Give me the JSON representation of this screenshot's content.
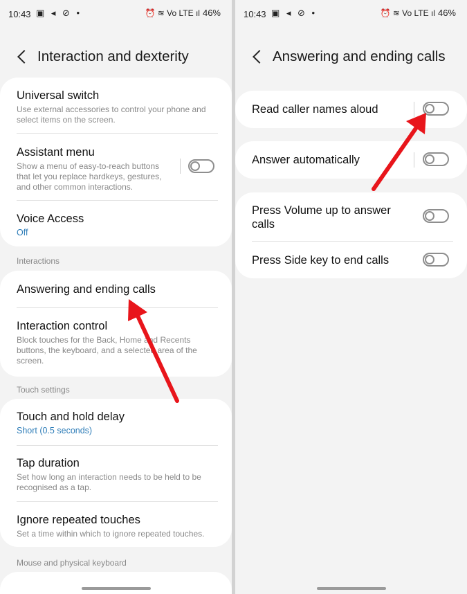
{
  "status": {
    "time": "10:43",
    "left_icons": "▣ ◂ ⊘ •",
    "right_icons": "⏰ ≋ Vo LTE ıl",
    "battery": "46%"
  },
  "left": {
    "title": "Interaction and dexterity",
    "items": [
      {
        "title": "Universal switch",
        "subtitle": "Use external accessories to control your phone and select items on the screen."
      },
      {
        "title": "Assistant menu",
        "subtitle": "Show a menu of easy-to-reach buttons that let you replace hardkeys, gestures, and other common interactions."
      },
      {
        "title": "Voice Access",
        "subtitle": "Off"
      }
    ],
    "section_interactions": "Interactions",
    "interactions": [
      {
        "title": "Answering and ending calls"
      },
      {
        "title": "Interaction control",
        "subtitle": "Block touches for the Back, Home and Recents buttons, the keyboard, and a selected area of the screen."
      }
    ],
    "section_touch": "Touch settings",
    "touch": [
      {
        "title": "Touch and hold delay",
        "subtitle": "Short (0.5 seconds)"
      },
      {
        "title": "Tap duration",
        "subtitle": "Set how long an interaction needs to be held to be recognised as a tap."
      },
      {
        "title": "Ignore repeated touches",
        "subtitle": "Set a time within which to ignore repeated touches."
      }
    ],
    "section_mouse": "Mouse and physical keyboard"
  },
  "right": {
    "title": "Answering and ending calls",
    "items": [
      {
        "title": "Read caller names aloud",
        "on": false
      },
      {
        "title": "Answer automatically",
        "on": false
      },
      {
        "title": "Press Volume up to answer calls",
        "on": false
      },
      {
        "title": "Press Side key to end calls",
        "on": false
      }
    ]
  },
  "colors": {
    "annotation_arrow": "#e8151b",
    "link_blue": "#2e7db8",
    "background": "#f3f3f3"
  }
}
